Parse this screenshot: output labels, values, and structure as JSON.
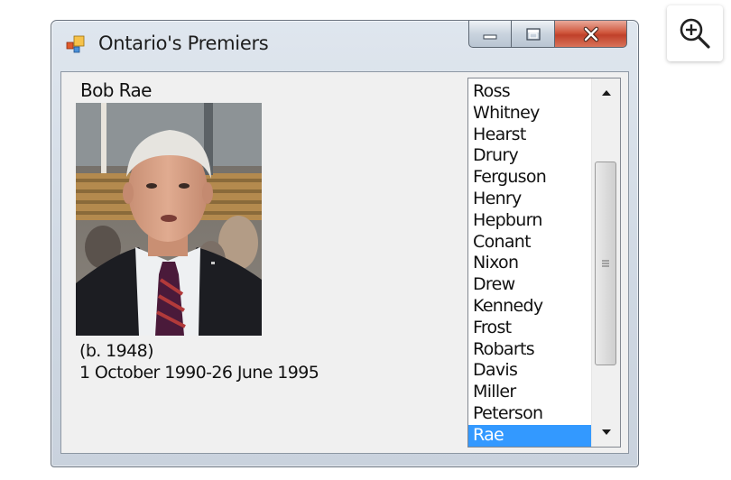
{
  "window": {
    "title": "Ontario's Premiers",
    "icon": "app-window-icon"
  },
  "caption_buttons": {
    "minimize_icon": "minimize-icon",
    "maximize_icon": "maximize-icon",
    "close_icon": "close-icon"
  },
  "zoom": {
    "icon": "zoom-in-icon"
  },
  "details": {
    "name": "Bob Rae",
    "birth": "(b. 1948)",
    "term": "1 October 1990-26 June 1995"
  },
  "premiers_list": {
    "items": [
      "Ross",
      "Whitney",
      "Hearst",
      "Drury",
      "Ferguson",
      "Henry",
      "Hepburn",
      "Conant",
      "Nixon",
      "Drew",
      "Kennedy",
      "Frost",
      "Robarts",
      "Davis",
      "Miller",
      "Peterson",
      "Rae"
    ],
    "selected": "Rae"
  },
  "colors": {
    "selection": "#3399ff",
    "close_button": "#c8452c",
    "window_frame": "#cfd8e3"
  }
}
